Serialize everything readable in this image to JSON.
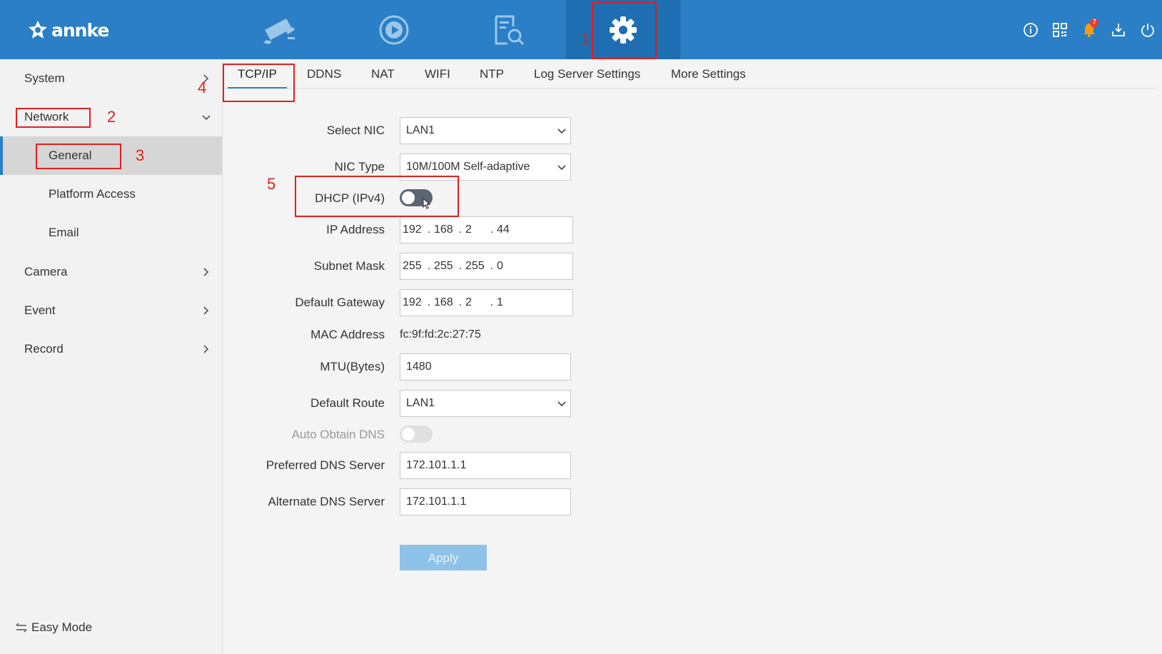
{
  "brand": {
    "logo_text": "annke"
  },
  "topnav": {
    "items": [
      {
        "icon": "camera-live-icon"
      },
      {
        "icon": "playback-icon"
      },
      {
        "icon": "search-file-icon"
      },
      {
        "icon": "gear-icon",
        "active": true
      }
    ],
    "right_icons": [
      "info-icon",
      "qr-code-icon",
      "bell-icon",
      "download-icon",
      "power-icon"
    ],
    "notification_count": "7"
  },
  "sidebar": {
    "items": [
      {
        "label": "System"
      },
      {
        "label": "Network"
      },
      {
        "label": "General",
        "active": true
      },
      {
        "label": "Platform Access"
      },
      {
        "label": "Email"
      },
      {
        "label": "Camera"
      },
      {
        "label": "Event"
      },
      {
        "label": "Record"
      }
    ],
    "easy_mode": "Easy Mode"
  },
  "tabs": [
    "TCP/IP",
    "DDNS",
    "NAT",
    "WIFI",
    "NTP",
    "Log Server Settings",
    "More Settings"
  ],
  "form": {
    "select_nic": {
      "label": "Select NIC",
      "value": "LAN1"
    },
    "nic_type": {
      "label": "NIC Type",
      "value": "10M/100M Self-adaptive"
    },
    "dhcp": {
      "label": "DHCP (IPv4)",
      "enabled": false
    },
    "ip_address": {
      "label": "IP Address",
      "octets": [
        "192",
        "168",
        "2",
        "44"
      ]
    },
    "subnet_mask": {
      "label": "Subnet Mask",
      "octets": [
        "255",
        "255",
        "255",
        "0"
      ]
    },
    "default_gateway": {
      "label": "Default Gateway",
      "octets": [
        "192",
        "168",
        "2",
        "1"
      ]
    },
    "mac_address": {
      "label": "MAC Address",
      "value": "fc:9f:fd:2c:27:75"
    },
    "mtu": {
      "label": "MTU(Bytes)",
      "value": "1480"
    },
    "default_route": {
      "label": "Default Route",
      "value": "LAN1"
    },
    "auto_dns": {
      "label": "Auto Obtain DNS",
      "enabled": false,
      "disabled": true
    },
    "preferred_dns": {
      "label": "Preferred DNS Server",
      "value": "172.101.1.1"
    },
    "alternate_dns": {
      "label": "Alternate DNS Server",
      "value": "172.101.1.1"
    },
    "apply_label": "Apply"
  },
  "annotations": [
    "1",
    "2",
    "3",
    "4",
    "5"
  ],
  "colors": {
    "header": "#2a7fc6",
    "annotation": "#e02020",
    "apply": "#8fc2e8"
  }
}
